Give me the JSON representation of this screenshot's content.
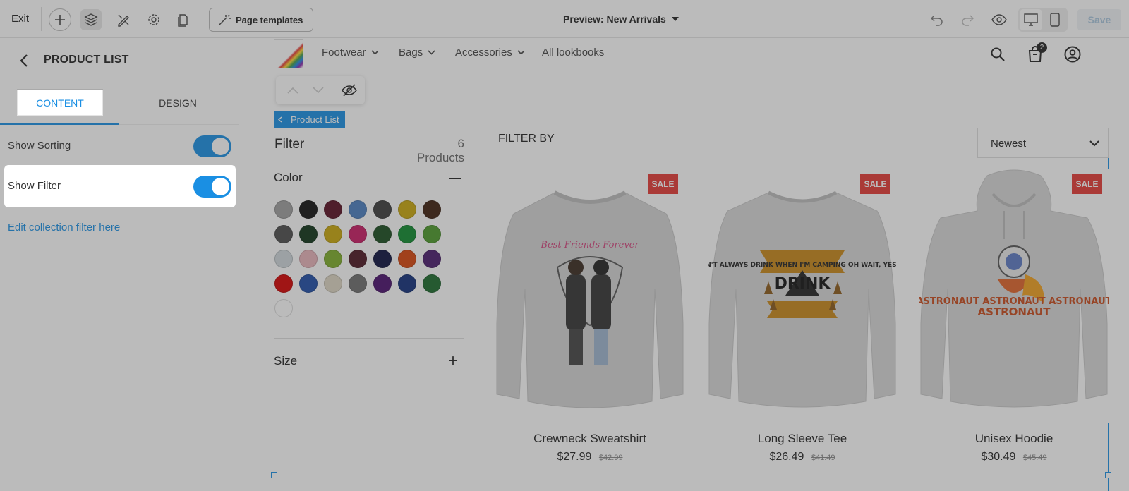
{
  "topbar": {
    "exit_label": "Exit",
    "page_templates_label": "Page templates",
    "preview_label": "Preview: New Arrivals",
    "save_label": "Save"
  },
  "sidebar": {
    "title": "PRODUCT LIST",
    "tabs": [
      {
        "label": "CONTENT"
      },
      {
        "label": "DESIGN"
      }
    ],
    "show_sorting_label": "Show Sorting",
    "show_sorting_on": true,
    "show_filter_label": "Show Filter",
    "show_filter_on": true,
    "edit_filter_link": "Edit collection filter here"
  },
  "site": {
    "nav": [
      {
        "label": "Footwear"
      },
      {
        "label": "Bags"
      },
      {
        "label": "Accessories"
      },
      {
        "label": "All lookbooks"
      }
    ],
    "cart_count": "2"
  },
  "section_tag": "Product List",
  "filter": {
    "title": "Filter",
    "product_count": "6 Products",
    "filter_by": "FILTER BY",
    "sort_value": "Newest",
    "color_title": "Color",
    "size_title": "Size",
    "colors": [
      "#9e9e9e",
      "#111111",
      "#5a0f22",
      "#4a7fc1",
      "#3d3d3d",
      "#c9a80c",
      "#3e1f0f",
      "#4d4d4d",
      "#0f3318",
      "#c9a80c",
      "#c91b64",
      "#1a4d1f",
      "#0e8a2e",
      "#4c9a2a",
      "#cfd8dc",
      "#e9b4bb",
      "#7fae2a",
      "#4d1622",
      "#0d1240",
      "#d8440b",
      "#4a1b6d",
      "#d60000",
      "#1f4ea8",
      "#ddd6c4",
      "#6e6e6e",
      "#4b0f6e",
      "#112f7c",
      "#1b6a2c",
      "#ffffff"
    ]
  },
  "products": [
    {
      "name": "Crewneck Sweatshirt",
      "price": "$27.99",
      "old_price": "$42.99",
      "badge": "SALE",
      "art": "Best Friends Forever"
    },
    {
      "name": "Long Sleeve Tee",
      "price": "$26.49",
      "old_price": "$41.49",
      "badge": "SALE",
      "art": "I DON'T ALWAYS DRINK WHEN I'M CAMPING OH WAIT, YES I DO"
    },
    {
      "name": "Unisex Hoodie",
      "price": "$30.49",
      "old_price": "$45.49",
      "badge": "SALE",
      "art": "ASTRONAUT ASTRONAUT ASTRONAUT"
    }
  ],
  "colors": {
    "accent": "#1a8fe3",
    "sale": "#e53935"
  }
}
